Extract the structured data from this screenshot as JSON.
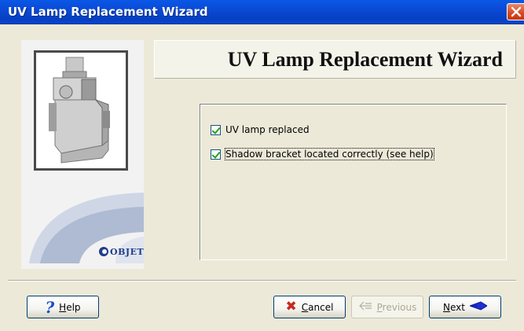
{
  "window": {
    "title": "UV Lamp Replacement Wizard"
  },
  "header": {
    "title": "UV Lamp Replacement Wizard"
  },
  "brand": {
    "logo_text": "OBJET"
  },
  "checkboxes": [
    {
      "label": "UV lamp replaced",
      "checked": true
    },
    {
      "label": "Shadow bracket located correctly (see help)",
      "checked": true
    }
  ],
  "buttons": {
    "help": {
      "label": "Help",
      "mnemonic": "H",
      "rest": "elp"
    },
    "cancel": {
      "label": "Cancel",
      "mnemonic": "C",
      "rest": "ancel"
    },
    "previous": {
      "label": "Previous",
      "mnemonic": "P",
      "rest": "revious",
      "enabled": false
    },
    "next": {
      "label": "Next",
      "mnemonic": "N",
      "rest": "ext"
    }
  },
  "colors": {
    "titlebar": "#0a4ad6",
    "dialog_bg": "#ece9d8",
    "accent_blue": "#1b4dc8",
    "cancel_red": "#c52a1e"
  },
  "icons": {
    "help": "question-mark-icon",
    "cancel": "red-x-icon",
    "previous": "left-arrow-icon",
    "next": "right-arrow-icon",
    "close": "close-icon"
  }
}
